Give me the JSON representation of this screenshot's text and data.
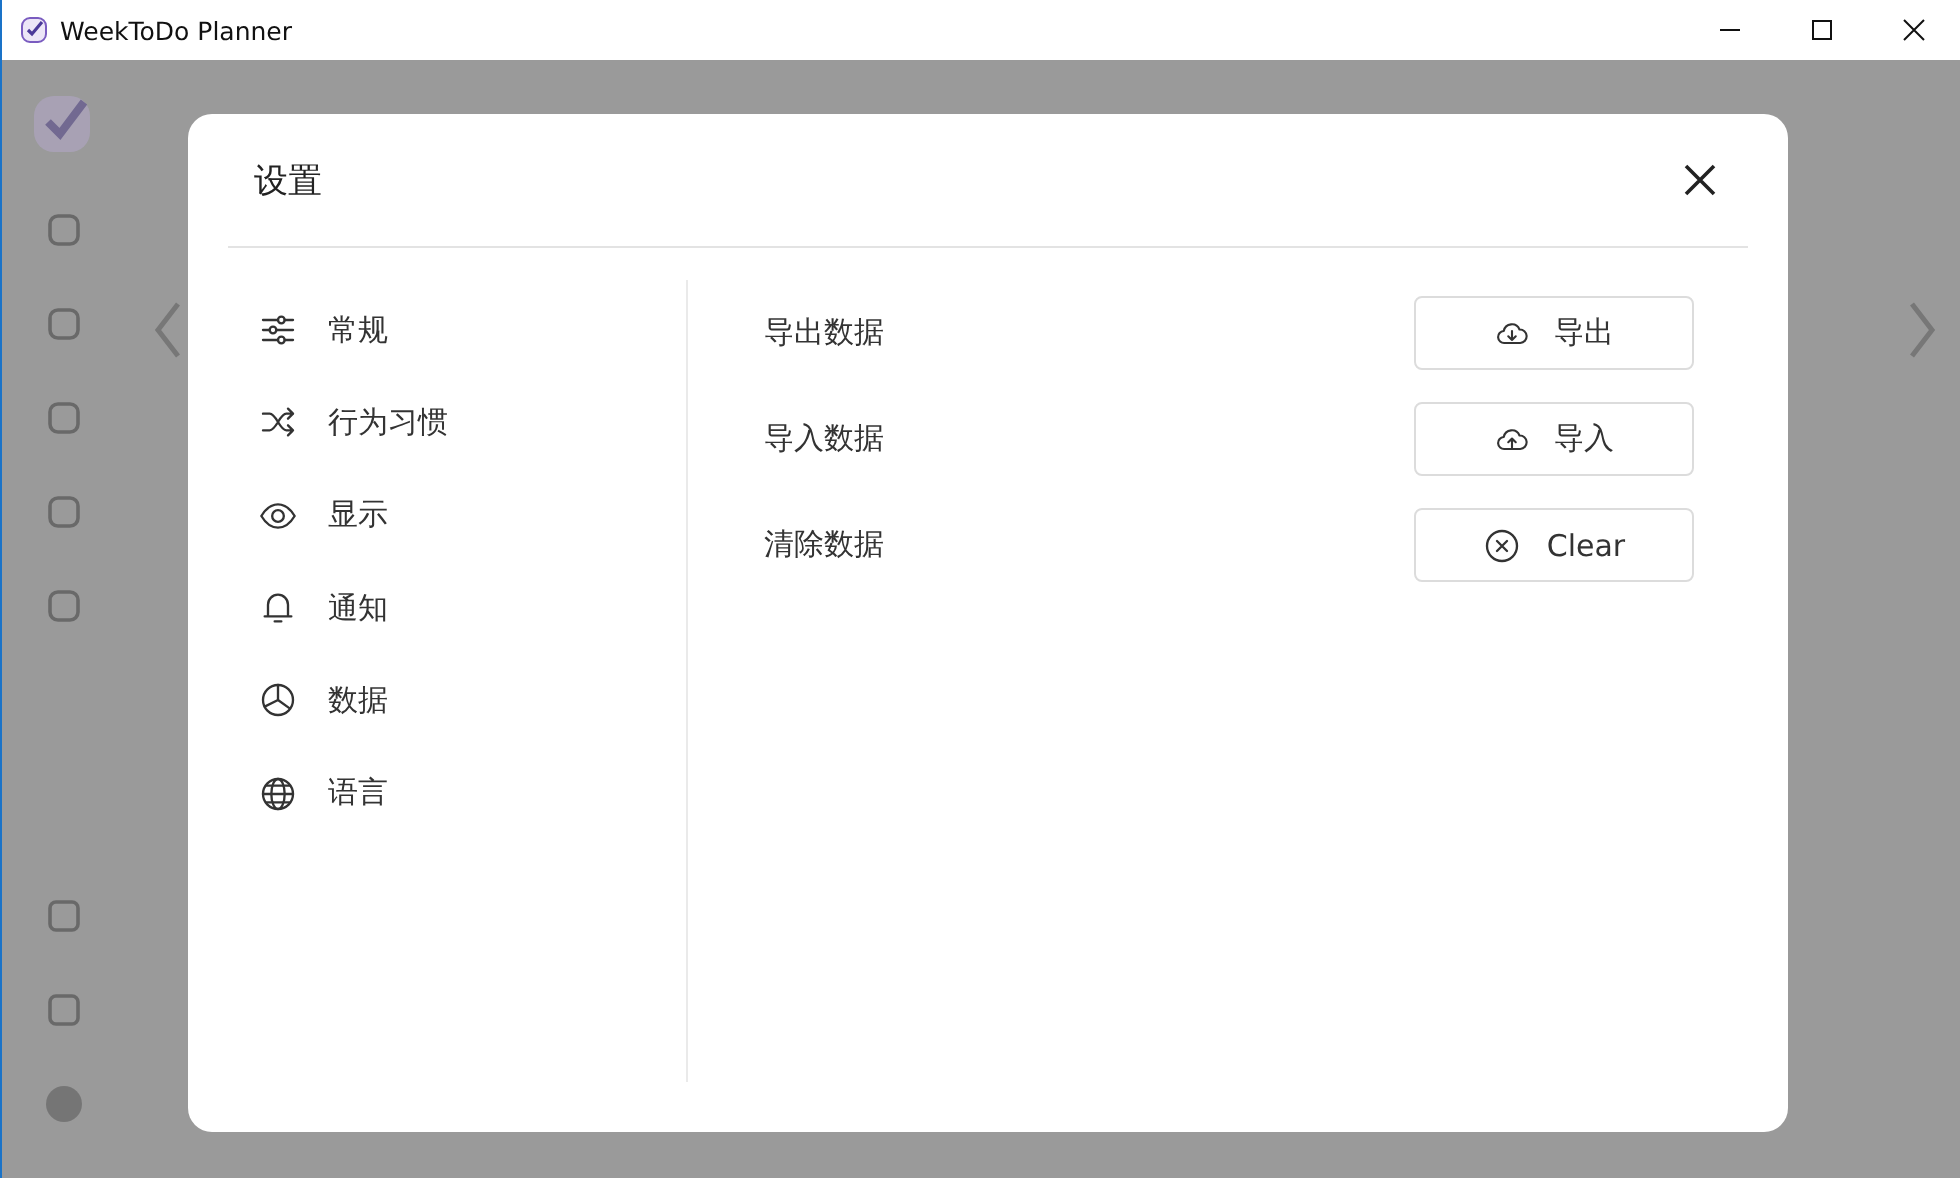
{
  "window": {
    "title": "WeekToDo Planner"
  },
  "dialog": {
    "title": "设置",
    "menu": [
      {
        "label": "常规"
      },
      {
        "label": "行为习惯"
      },
      {
        "label": "显示"
      },
      {
        "label": "通知"
      },
      {
        "label": "数据"
      },
      {
        "label": "语言"
      }
    ],
    "rows": [
      {
        "label": "导出数据",
        "button": {
          "kind": "export",
          "label": "导出"
        }
      },
      {
        "label": "导入数据",
        "button": {
          "kind": "import",
          "label": "导入"
        }
      },
      {
        "label": "清除数据",
        "button": {
          "kind": "clear",
          "label": "Clear"
        }
      }
    ]
  }
}
